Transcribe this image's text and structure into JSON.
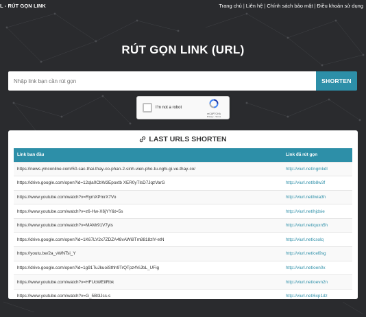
{
  "brand": "L - RÚT GỌN LINK",
  "nav": [
    {
      "label": "Trang chủ"
    },
    {
      "label": "Liên hệ"
    },
    {
      "label": "Chính sách bảo mật"
    },
    {
      "label": "Điều khoản sử dụng"
    }
  ],
  "nav_separator": "|",
  "hero": {
    "title": "RÚT GỌN LINK (URL)"
  },
  "search": {
    "placeholder": "Nhập link bạn cần rút gọn",
    "value": "",
    "button_label": "SHORTEN"
  },
  "captcha": {
    "label": "I'm not a robot",
    "brand": "reCAPTCHA",
    "links": "Privacy - Terms"
  },
  "last_urls": {
    "title": "LAST URLS SHORTEN",
    "columns": [
      "Link ban đầu",
      "Link đã rút gọn"
    ],
    "rows": [
      {
        "original": "https://news.ymconline.com/50-sac-thai-thay-co-phan-2-sinh-vien-pho-tu-nghi-gi-ve-thay-co/",
        "short": "http://viurl.net/ngmkdl"
      },
      {
        "original": "https://drive.google.com/open?id=12qla0CbW3Epoxtb XER0yTlsD7JqzVarG",
        "short": "http://viurl.net/b8w3f"
      },
      {
        "original": "https://www.youtube.com/watch?v=RymXPmrX7Vo",
        "short": "http://viurl.net/lwia3h"
      },
      {
        "original": "https://www.youtube.com/watch?v=z6-Hw-X6jYY&t=5s",
        "short": "http://viurl.net/hjdsie"
      },
      {
        "original": "https://www.youtube.com/watch?v=MAMr91V7yis",
        "short": "http://viurl.net/quxn5h"
      },
      {
        "original": "https://drive.google.com/open?id=1K67LV2x7ZDZA48vAWi8Tm8818zlY-etN",
        "short": "http://viurl.net/csolq"
      },
      {
        "original": "https://youtu.be/2a_vWNTsi_Y",
        "short": "http://viurl.net/cel9sg"
      },
      {
        "original": "https://drive.google.com/open?id=1g91TuJkuoiSthh9TrQTpz4ViJbL_UFig",
        "short": "http://viurl.net/oen0x"
      },
      {
        "original": "https://www.youtube.com/watch?v=HFUcWEiIRbk",
        "short": "http://viurl.net/oevn2n"
      },
      {
        "original": "https://www.youtube.com/watch?v=G_5Bl3Jss-s",
        "short": "http://viurl.net/6xp1dz"
      }
    ]
  },
  "colors": {
    "background": "#2a2b2e",
    "accent": "#2d8fa8",
    "panel": "#ffffff"
  },
  "icons": {
    "title_icon": "link-icon",
    "captcha_logo": "recaptcha-icon"
  }
}
